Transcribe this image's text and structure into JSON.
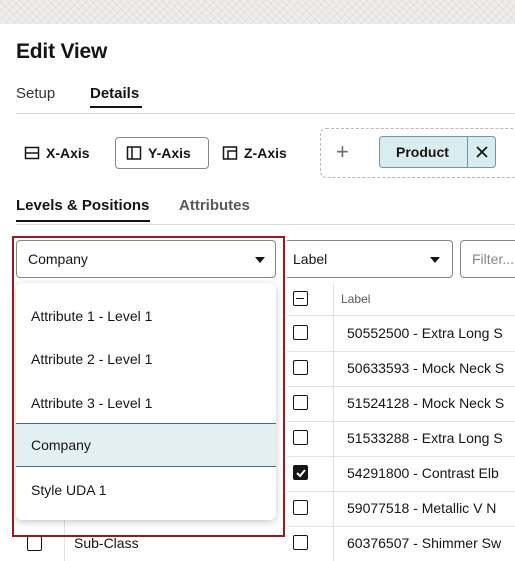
{
  "page": {
    "title": "Edit View"
  },
  "tabs": [
    {
      "label": "Setup",
      "active": false
    },
    {
      "label": "Details",
      "active": true
    }
  ],
  "axes": {
    "x_label": "X-Axis",
    "y_label": "Y-Axis",
    "z_label": "Z-Axis",
    "selected": "Y-Axis"
  },
  "drop_zone": {
    "chip_label": "Product"
  },
  "subtabs": [
    {
      "label": "Levels & Positions",
      "active": true
    },
    {
      "label": "Attributes",
      "active": false
    }
  ],
  "level_select": {
    "value": "Company"
  },
  "label_select": {
    "value": "Label"
  },
  "filter_input": {
    "placeholder": "Filter..."
  },
  "level_dropdown": {
    "options": [
      "Attribute 1 - Level 1",
      "Attribute 2 - Level 1",
      "Attribute 3 - Level 1",
      "Company",
      "Style UDA 1"
    ],
    "selected": "Company"
  },
  "left_list": {
    "visible_row": "Sub-Class"
  },
  "positions": {
    "column_header": "Label",
    "rows": [
      {
        "label": "50552500 - Extra Long S",
        "checked": false
      },
      {
        "label": "50633593 - Mock Neck S",
        "checked": false
      },
      {
        "label": "51524128 - Mock Neck S",
        "checked": false
      },
      {
        "label": "51533288 - Extra Long S",
        "checked": false
      },
      {
        "label": "54291800 - Contrast Elb",
        "checked": true
      },
      {
        "label": "59077518 - Metallic V N",
        "checked": false
      },
      {
        "label": "60376507 - Shimmer Sw",
        "checked": false
      }
    ]
  },
  "colors": {
    "highlight_frame": "#a3161a",
    "chip_background": "#d9edf1",
    "selected_option_background": "#e2f0f4"
  }
}
